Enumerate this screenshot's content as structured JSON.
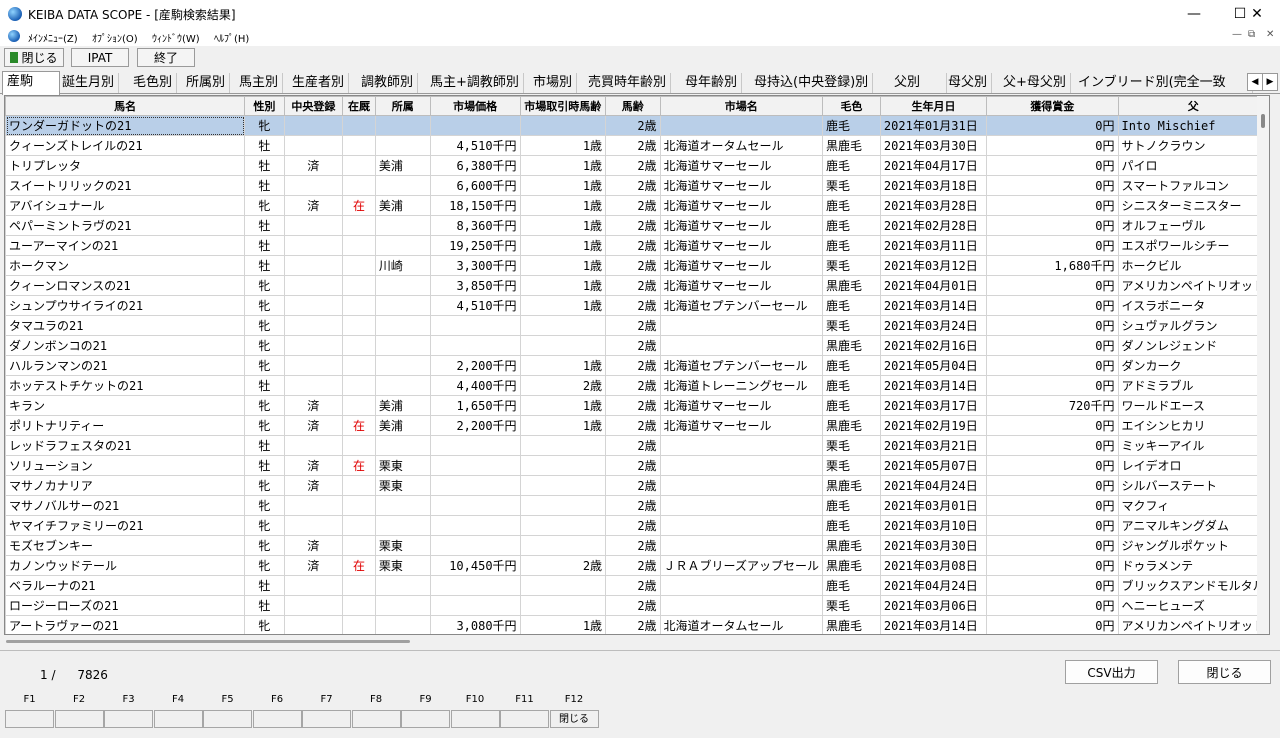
{
  "window": {
    "title": "KEIBA DATA SCOPE - [産駒検索結果]",
    "minimize": "—",
    "maximize": "☐",
    "close": "✕"
  },
  "menu": {
    "items": [
      "ﾒｲﾝﾒﾆｭｰ(Z)",
      "ｵﾌﾟｼｮﾝ(O)",
      "ｳｨﾝﾄﾞｳ(W)",
      "ﾍﾙﾌﾟ(H)"
    ],
    "mdi_min": "—",
    "mdi_restore": "⧉",
    "mdi_close": "✕"
  },
  "toolbar": {
    "close_label": "閉じる",
    "ipat_label": "IPAT",
    "exit_label": "終了"
  },
  "tabs": [
    "産駒",
    "誕生月別",
    "毛色別",
    "所属別",
    "馬主別",
    "生産者別",
    "調教師別",
    "馬主+調教師別",
    "市場別",
    "売買時年齢別",
    "母年齢別",
    "母持込(中央登録)別",
    "父別",
    "母父別",
    "父+母父別",
    "インブリード別(完全一致"
  ],
  "tab_arrows": {
    "left": "◀",
    "right": "▶"
  },
  "columns": [
    "馬名",
    "性別",
    "中央登録",
    "在厩",
    "所属",
    "市場価格",
    "市場取引時馬齢",
    "馬齢",
    "市場名",
    "毛色",
    "生年月日",
    "獲得賞金",
    "父"
  ],
  "rows": [
    [
      "ワンダーガドットの21",
      "牝",
      "",
      "",
      "",
      "",
      "",
      "2歳",
      "",
      "鹿毛",
      "2021年01月31日",
      "0円",
      "Into Mischief"
    ],
    [
      "クィーンズトレイルの21",
      "牡",
      "",
      "",
      "",
      "4,510千円",
      "1歳",
      "2歳",
      "北海道オータムセール",
      "黒鹿毛",
      "2021年03月30日",
      "0円",
      "サトノクラウン"
    ],
    [
      "トリプレッタ",
      "牡",
      "済",
      "",
      "美浦",
      "6,380千円",
      "1歳",
      "2歳",
      "北海道サマーセール",
      "鹿毛",
      "2021年04月17日",
      "0円",
      "パイロ"
    ],
    [
      "スイートリリックの21",
      "牡",
      "",
      "",
      "",
      "6,600千円",
      "1歳",
      "2歳",
      "北海道サマーセール",
      "栗毛",
      "2021年03月18日",
      "0円",
      "スマートファルコン"
    ],
    [
      "アバイシュナール",
      "牝",
      "済",
      "在",
      "美浦",
      "18,150千円",
      "1歳",
      "2歳",
      "北海道サマーセール",
      "鹿毛",
      "2021年03月28日",
      "0円",
      "シニスターミニスター"
    ],
    [
      "ペパーミントラヴの21",
      "牡",
      "",
      "",
      "",
      "8,360千円",
      "1歳",
      "2歳",
      "北海道サマーセール",
      "鹿毛",
      "2021年02月28日",
      "0円",
      "オルフェーヴル"
    ],
    [
      "ユーアーマインの21",
      "牡",
      "",
      "",
      "",
      "19,250千円",
      "1歳",
      "2歳",
      "北海道サマーセール",
      "鹿毛",
      "2021年03月11日",
      "0円",
      "エスポワールシチー"
    ],
    [
      "ホークマン",
      "牡",
      "",
      "",
      "川崎",
      "3,300千円",
      "1歳",
      "2歳",
      "北海道サマーセール",
      "栗毛",
      "2021年03月12日",
      "1,680千円",
      "ホークビル"
    ],
    [
      "クィーンロマンスの21",
      "牝",
      "",
      "",
      "",
      "3,850千円",
      "1歳",
      "2歳",
      "北海道サマーセール",
      "黒鹿毛",
      "2021年04月01日",
      "0円",
      "アメリカンペイトリオット"
    ],
    [
      "シュンプウサイライの21",
      "牝",
      "",
      "",
      "",
      "4,510千円",
      "1歳",
      "2歳",
      "北海道セプテンバーセール",
      "鹿毛",
      "2021年03月14日",
      "0円",
      "イスラボニータ"
    ],
    [
      "タマユラの21",
      "牝",
      "",
      "",
      "",
      "",
      "",
      "2歳",
      "",
      "栗毛",
      "2021年03月24日",
      "0円",
      "シュヴァルグラン"
    ],
    [
      "ダノンボンコの21",
      "牝",
      "",
      "",
      "",
      "",
      "",
      "2歳",
      "",
      "黒鹿毛",
      "2021年02月16日",
      "0円",
      "ダノンレジェンド"
    ],
    [
      "ハルランマンの21",
      "牝",
      "",
      "",
      "",
      "2,200千円",
      "1歳",
      "2歳",
      "北海道セプテンバーセール",
      "鹿毛",
      "2021年05月04日",
      "0円",
      "ダンカーク"
    ],
    [
      "ホッテストチケットの21",
      "牡",
      "",
      "",
      "",
      "4,400千円",
      "2歳",
      "2歳",
      "北海道トレーニングセール",
      "鹿毛",
      "2021年03月14日",
      "0円",
      "アドミラブル"
    ],
    [
      "キラン",
      "牝",
      "済",
      "",
      "美浦",
      "1,650千円",
      "1歳",
      "2歳",
      "北海道サマーセール",
      "鹿毛",
      "2021年03月17日",
      "720千円",
      "ワールドエース"
    ],
    [
      "ポリトナリティー",
      "牝",
      "済",
      "在",
      "美浦",
      "2,200千円",
      "1歳",
      "2歳",
      "北海道サマーセール",
      "黒鹿毛",
      "2021年02月19日",
      "0円",
      "エイシンヒカリ"
    ],
    [
      "レッドラフェスタの21",
      "牡",
      "",
      "",
      "",
      "",
      "",
      "2歳",
      "",
      "栗毛",
      "2021年03月21日",
      "0円",
      "ミッキーアイル"
    ],
    [
      "ソリューション",
      "牡",
      "済",
      "在",
      "栗東",
      "",
      "",
      "2歳",
      "",
      "栗毛",
      "2021年05月07日",
      "0円",
      "レイデオロ"
    ],
    [
      "マサノカナリア",
      "牝",
      "済",
      "",
      "栗東",
      "",
      "",
      "2歳",
      "",
      "黒鹿毛",
      "2021年04月24日",
      "0円",
      "シルバーステート"
    ],
    [
      "マサノバルサーの21",
      "牝",
      "",
      "",
      "",
      "",
      "",
      "2歳",
      "",
      "鹿毛",
      "2021年03月01日",
      "0円",
      "マクフィ"
    ],
    [
      "ヤマイチファミリーの21",
      "牝",
      "",
      "",
      "",
      "",
      "",
      "2歳",
      "",
      "鹿毛",
      "2021年03月10日",
      "0円",
      "アニマルキングダム"
    ],
    [
      "モズセブンキー",
      "牝",
      "済",
      "",
      "栗東",
      "",
      "",
      "2歳",
      "",
      "黒鹿毛",
      "2021年03月30日",
      "0円",
      "ジャングルポケット"
    ],
    [
      "カノンウッドテール",
      "牝",
      "済",
      "在",
      "栗東",
      "10,450千円",
      "2歳",
      "2歳",
      "ＪＲＡブリーズアップセール",
      "黒鹿毛",
      "2021年03月08日",
      "0円",
      "ドゥラメンテ"
    ],
    [
      "ベラルーナの21",
      "牡",
      "",
      "",
      "",
      "",
      "",
      "2歳",
      "",
      "鹿毛",
      "2021年04月24日",
      "0円",
      "ブリックスアンドモルタル"
    ],
    [
      "ロージーローズの21",
      "牡",
      "",
      "",
      "",
      "",
      "",
      "2歳",
      "",
      "栗毛",
      "2021年03月06日",
      "0円",
      "ヘニーヒューズ"
    ],
    [
      "アートラヴァーの21",
      "牝",
      "",
      "",
      "",
      "3,080千円",
      "1歳",
      "2歳",
      "北海道オータムセール",
      "黒鹿毛",
      "2021年03月14日",
      "0円",
      "アメリカンペイトリオット"
    ]
  ],
  "selected_row": 0,
  "page": {
    "current": "1 /",
    "total": "7826"
  },
  "bottom": {
    "csv_label": "CSV出力",
    "close_label": "閉じる"
  },
  "fkeys": [
    {
      "label": "F1",
      "action": ""
    },
    {
      "label": "F2",
      "action": ""
    },
    {
      "label": "F3",
      "action": ""
    },
    {
      "label": "F4",
      "action": ""
    },
    {
      "label": "F5",
      "action": ""
    },
    {
      "label": "F6",
      "action": ""
    },
    {
      "label": "F7",
      "action": ""
    },
    {
      "label": "F8",
      "action": ""
    },
    {
      "label": "F9",
      "action": ""
    },
    {
      "label": "F10",
      "action": ""
    },
    {
      "label": "F11",
      "action": ""
    },
    {
      "label": "F12",
      "action": "閉じる"
    }
  ]
}
